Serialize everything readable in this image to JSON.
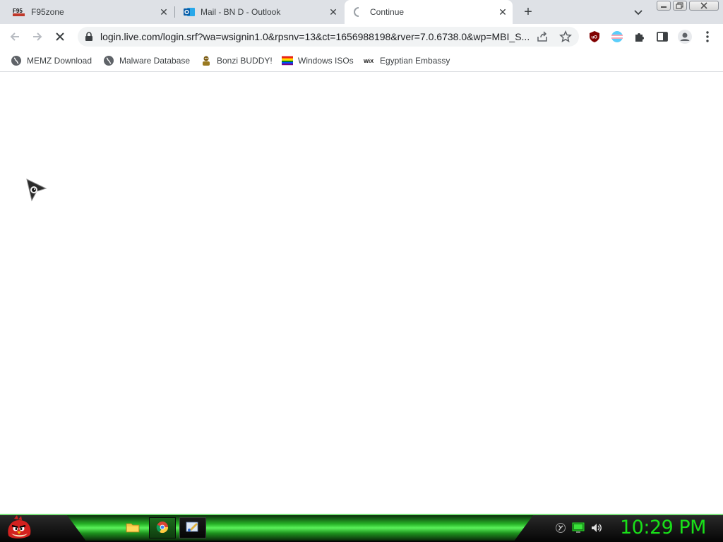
{
  "browser": {
    "tabs": [
      {
        "title": "F95zone",
        "favicon": "f95zone-icon",
        "active": false
      },
      {
        "title": "Mail - BN D - Outlook",
        "favicon": "outlook-icon",
        "active": false
      },
      {
        "title": "Continue",
        "favicon": "loading-spinner-icon",
        "active": true
      }
    ],
    "address_bar": {
      "url": "login.live.com/login.srf?wa=wsignin1.0&rpsnv=13&ct=1656988198&rver=7.0.6738.0&wp=MBI_S..."
    },
    "bookmarks": [
      {
        "label": "MEMZ Download",
        "icon": "globe-icon"
      },
      {
        "label": "Malware Database",
        "icon": "globe-icon"
      },
      {
        "label": "Bonzi BUDDY!",
        "icon": "bonzi-icon"
      },
      {
        "label": "Windows ISOs",
        "icon": "rainbow-flag-icon"
      },
      {
        "label": "Egyptian Embassy",
        "icon": "wix-icon"
      }
    ],
    "extensions": [
      "ublock-origin-icon",
      "flag-extension-icon",
      "puzzle-icon",
      "sidepanel-icon",
      "profile-icon",
      "menu-icon"
    ]
  },
  "taskbar": {
    "clock": "10:29 PM",
    "tasks": [
      "file-explorer-icon",
      "chrome-icon",
      "paint-icon"
    ],
    "tray": [
      "network-icon",
      "monitor-icon",
      "volume-icon"
    ]
  },
  "colors": {
    "tab_strip": "#dee1e6",
    "clock_green": "#19e019",
    "taskbar_glow": "#27b327"
  }
}
